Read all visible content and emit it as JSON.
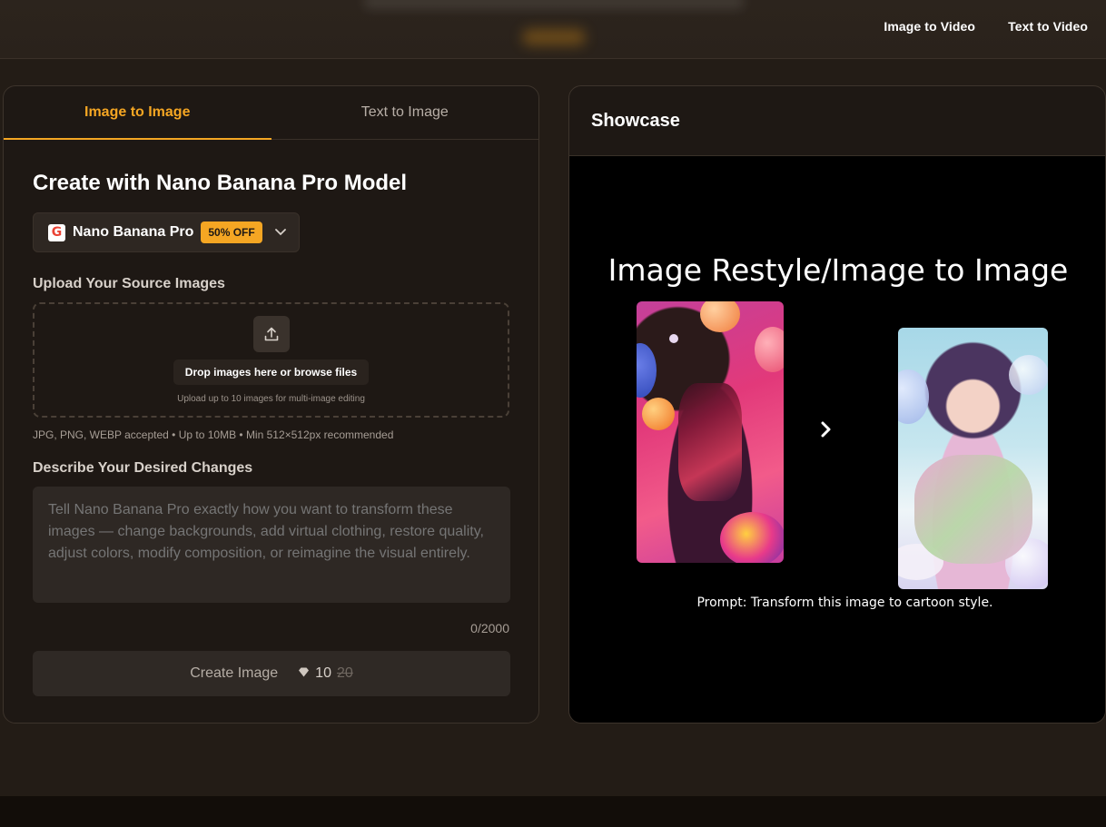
{
  "topnav": {
    "items": [
      {
        "label": "Image to Video"
      },
      {
        "label": "Text to Video"
      }
    ]
  },
  "left_panel": {
    "tabs": [
      {
        "label": "Image to Image",
        "active": true
      },
      {
        "label": "Text to Image",
        "active": false
      }
    ],
    "heading": "Create with Nano Banana Pro Model",
    "model_select": {
      "icon": "google-g-icon",
      "name": "Nano Banana Pro",
      "badge": "50% OFF"
    },
    "upload": {
      "label": "Upload Your Source Images",
      "button": "Drop images here or browse files",
      "hint": "Upload up to 10 images for multi-image editing",
      "accepted": "JPG, PNG, WEBP accepted • Up to 10MB • Min 512×512px recommended"
    },
    "describe": {
      "label": "Describe Your Desired Changes",
      "placeholder": "Tell Nano Banana Pro exactly how you want to transform these images — change backgrounds, add virtual clothing, restore quality, adjust colors, modify composition, or reimagine the visual entirely.",
      "counter": "0/2000"
    },
    "create_button": {
      "label": "Create Image",
      "cost": "10",
      "old_cost": "20"
    }
  },
  "showcase": {
    "title": "Showcase",
    "image_title": "Image Restyle/Image to Image",
    "prompt": "Prompt: Transform this image to cartoon style."
  },
  "colors": {
    "accent": "#f5a623",
    "background": "#231c16",
    "panel": "#1e1814"
  }
}
